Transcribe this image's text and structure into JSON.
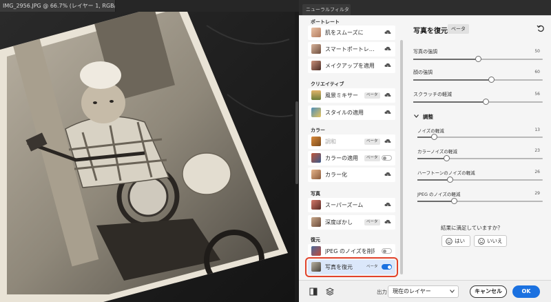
{
  "document": {
    "tab_title": "IMG_2956.JPG @ 66.7% (レイヤー 1, RGB/8*) *"
  },
  "panel": {
    "tab_label": "ニューラルフィルター"
  },
  "filters": {
    "portrait": {
      "category": "ポートレート",
      "items": [
        {
          "label": "肌をスムーズに"
        },
        {
          "label": "スマートポートレ…"
        },
        {
          "label": "メイクアップを適用"
        }
      ]
    },
    "creative": {
      "category": "クリエイティブ",
      "items": [
        {
          "label": "風景ミキサー",
          "badge": "ベータ"
        },
        {
          "label": "スタイルの適用"
        }
      ]
    },
    "color": {
      "category": "カラー",
      "items": [
        {
          "label": "調和",
          "badge": "ベータ"
        },
        {
          "label": "カラーの適用",
          "badge": "ベータ"
        },
        {
          "label": "カラー化"
        }
      ]
    },
    "photo": {
      "category": "写真",
      "items": [
        {
          "label": "スーパーズーム"
        },
        {
          "label": "深度ぼかし",
          "badge": "ベータ"
        }
      ]
    },
    "restore": {
      "category": "復元",
      "items": [
        {
          "label": "JPEG のノイズを削除"
        },
        {
          "label": "写真を復元",
          "badge": "ベータ"
        }
      ]
    }
  },
  "settings": {
    "title": "写真を復元",
    "title_badge": "ベータ",
    "sliders": [
      {
        "label": "写真の強調",
        "value": 50
      },
      {
        "label": "顔の強調",
        "value": 60
      },
      {
        "label": "スクラッチの軽減",
        "value": 56
      }
    ],
    "adjust": {
      "label": "調整",
      "sliders": [
        {
          "label": "ノイズの軽減",
          "value": 13
        },
        {
          "label": "カラーノイズの軽減",
          "value": 23
        },
        {
          "label": "ハーフトーンのノイズの軽減",
          "value": 26
        },
        {
          "label": "JPEG のノイズの軽減",
          "value": 29
        }
      ]
    },
    "feedback": {
      "question": "結果に満足していますか？",
      "yes": "はい",
      "no": "いいえ"
    }
  },
  "footer": {
    "output_label": "出力",
    "output_value": "現在のレイヤー",
    "cancel": "キャンセル",
    "ok": "OK"
  },
  "colors": {
    "accent": "#1b71e0",
    "highlight": "#e2422a"
  }
}
